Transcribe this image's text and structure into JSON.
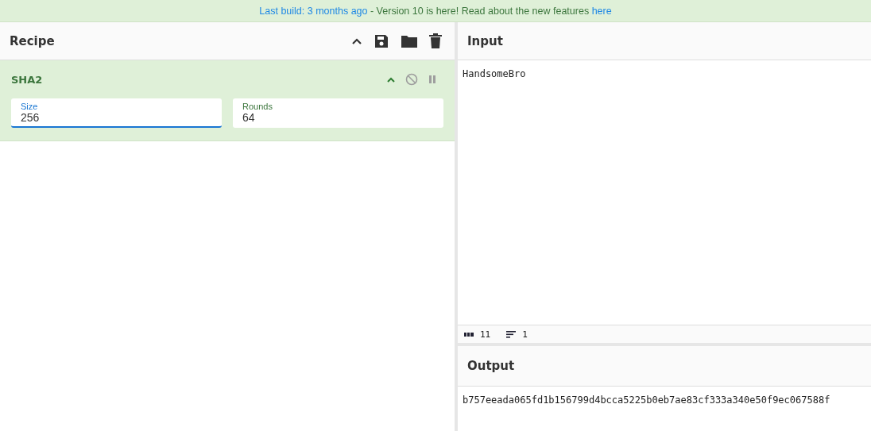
{
  "banner": {
    "build_link": "Last build: 3 months ago",
    "message": "- Version 10 is here! Read about the new features",
    "link": "here"
  },
  "recipe": {
    "title": "Recipe",
    "operations": [
      {
        "name": "SHA2",
        "expanded": true,
        "disabled": false,
        "paused": false,
        "args": [
          {
            "label": "Size",
            "value": "256",
            "focused": true
          },
          {
            "label": "Rounds",
            "value": "64",
            "focused": false
          }
        ]
      }
    ]
  },
  "input": {
    "title": "Input",
    "value": "HandsomeBro",
    "status": {
      "length": "11",
      "lines": "1"
    }
  },
  "output": {
    "title": "Output",
    "value": "b757eeada065fd1b156799d4bcca5225b0eb7ae83cf333a340e50f9ec067588f"
  }
}
